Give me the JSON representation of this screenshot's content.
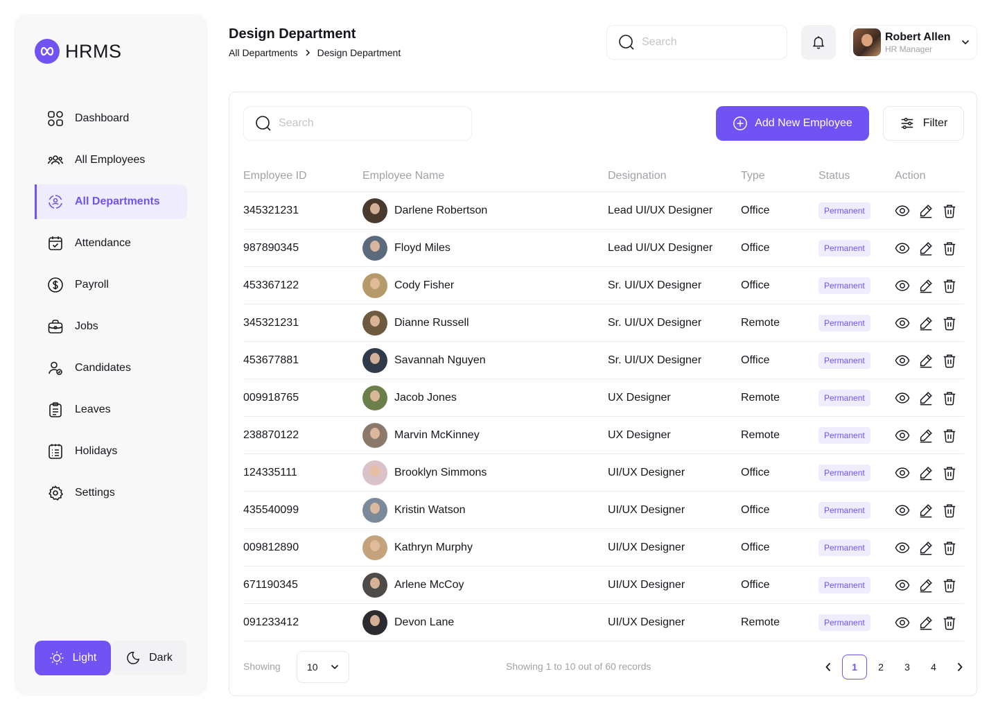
{
  "app": {
    "name": "HRMS"
  },
  "sidebar": {
    "items": [
      {
        "label": "Dashboard",
        "icon": "dashboard-icon",
        "active": false
      },
      {
        "label": "All Employees",
        "icon": "employees-icon",
        "active": false
      },
      {
        "label": "All Departments",
        "icon": "departments-icon",
        "active": true
      },
      {
        "label": "Attendance",
        "icon": "calendar-check-icon",
        "active": false
      },
      {
        "label": "Payroll",
        "icon": "dollar-circle-icon",
        "active": false
      },
      {
        "label": "Jobs",
        "icon": "briefcase-icon",
        "active": false
      },
      {
        "label": "Candidates",
        "icon": "candidates-icon",
        "active": false
      },
      {
        "label": "Leaves",
        "icon": "clipboard-icon",
        "active": false
      },
      {
        "label": "Holidays",
        "icon": "list-icon",
        "active": false
      },
      {
        "label": "Settings",
        "icon": "gear-icon",
        "active": false
      }
    ],
    "theme": {
      "light_label": "Light",
      "dark_label": "Dark",
      "selected": "Light"
    }
  },
  "header": {
    "title": "Design Department",
    "breadcrumb": [
      "All Departments",
      "Design Department"
    ],
    "search_placeholder": "Search",
    "user": {
      "name": "Robert Allen",
      "role": "HR Manager"
    }
  },
  "toolbar": {
    "search_placeholder": "Search",
    "add_label": "Add New Employee",
    "filter_label": "Filter"
  },
  "table": {
    "columns": [
      "Employee ID",
      "Employee Name",
      "Designation",
      "Type",
      "Status",
      "Action"
    ],
    "rows": [
      {
        "id": "345321231",
        "name": "Darlene Robertson",
        "designation": "Lead UI/UX Designer",
        "type": "Office",
        "status": "Permanent"
      },
      {
        "id": "987890345",
        "name": "Floyd Miles",
        "designation": "Lead UI/UX Designer",
        "type": "Office",
        "status": "Permanent"
      },
      {
        "id": "453367122",
        "name": "Cody Fisher",
        "designation": "Sr. UI/UX Designer",
        "type": "Office",
        "status": "Permanent"
      },
      {
        "id": "345321231",
        "name": "Dianne Russell",
        "designation": "Sr. UI/UX Designer",
        "type": "Remote",
        "status": "Permanent"
      },
      {
        "id": "453677881",
        "name": "Savannah Nguyen",
        "designation": "Sr. UI/UX Designer",
        "type": "Office",
        "status": "Permanent"
      },
      {
        "id": "009918765",
        "name": "Jacob Jones",
        "designation": "UX Designer",
        "type": "Remote",
        "status": "Permanent"
      },
      {
        "id": "238870122",
        "name": "Marvin McKinney",
        "designation": "UX Designer",
        "type": "Remote",
        "status": "Permanent"
      },
      {
        "id": "124335111",
        "name": "Brooklyn Simmons",
        "designation": "UI/UX Designer",
        "type": "Office",
        "status": "Permanent"
      },
      {
        "id": "435540099",
        "name": "Kristin Watson",
        "designation": "UI/UX Designer",
        "type": "Office",
        "status": "Permanent"
      },
      {
        "id": "009812890",
        "name": "Kathryn Murphy",
        "designation": "UI/UX Designer",
        "type": "Office",
        "status": "Permanent"
      },
      {
        "id": "671190345",
        "name": "Arlene McCoy",
        "designation": "UI/UX Designer",
        "type": "Office",
        "status": "Permanent"
      },
      {
        "id": "091233412",
        "name": "Devon Lane",
        "designation": "UI/UX Designer",
        "type": "Remote",
        "status": "Permanent"
      }
    ],
    "avatar_colors": [
      "#4a3a2e",
      "#5b6b7c",
      "#b59a6a",
      "#6d5a3f",
      "#2f3a4a",
      "#6a7f4a",
      "#8b7a6b",
      "#d9c2c8",
      "#7a8a9a",
      "#c4a27c",
      "#4d4a48",
      "#2b2b30"
    ]
  },
  "footer": {
    "showing_label": "Showing",
    "page_size": "10",
    "records_text": "Showing 1 to 10 out of 60 records",
    "pages": [
      "1",
      "2",
      "3",
      "4"
    ],
    "current_page": "1"
  },
  "colors": {
    "accent": "#7152f3",
    "accent_soft": "#efecfe",
    "muted": "#a2a1a8"
  }
}
